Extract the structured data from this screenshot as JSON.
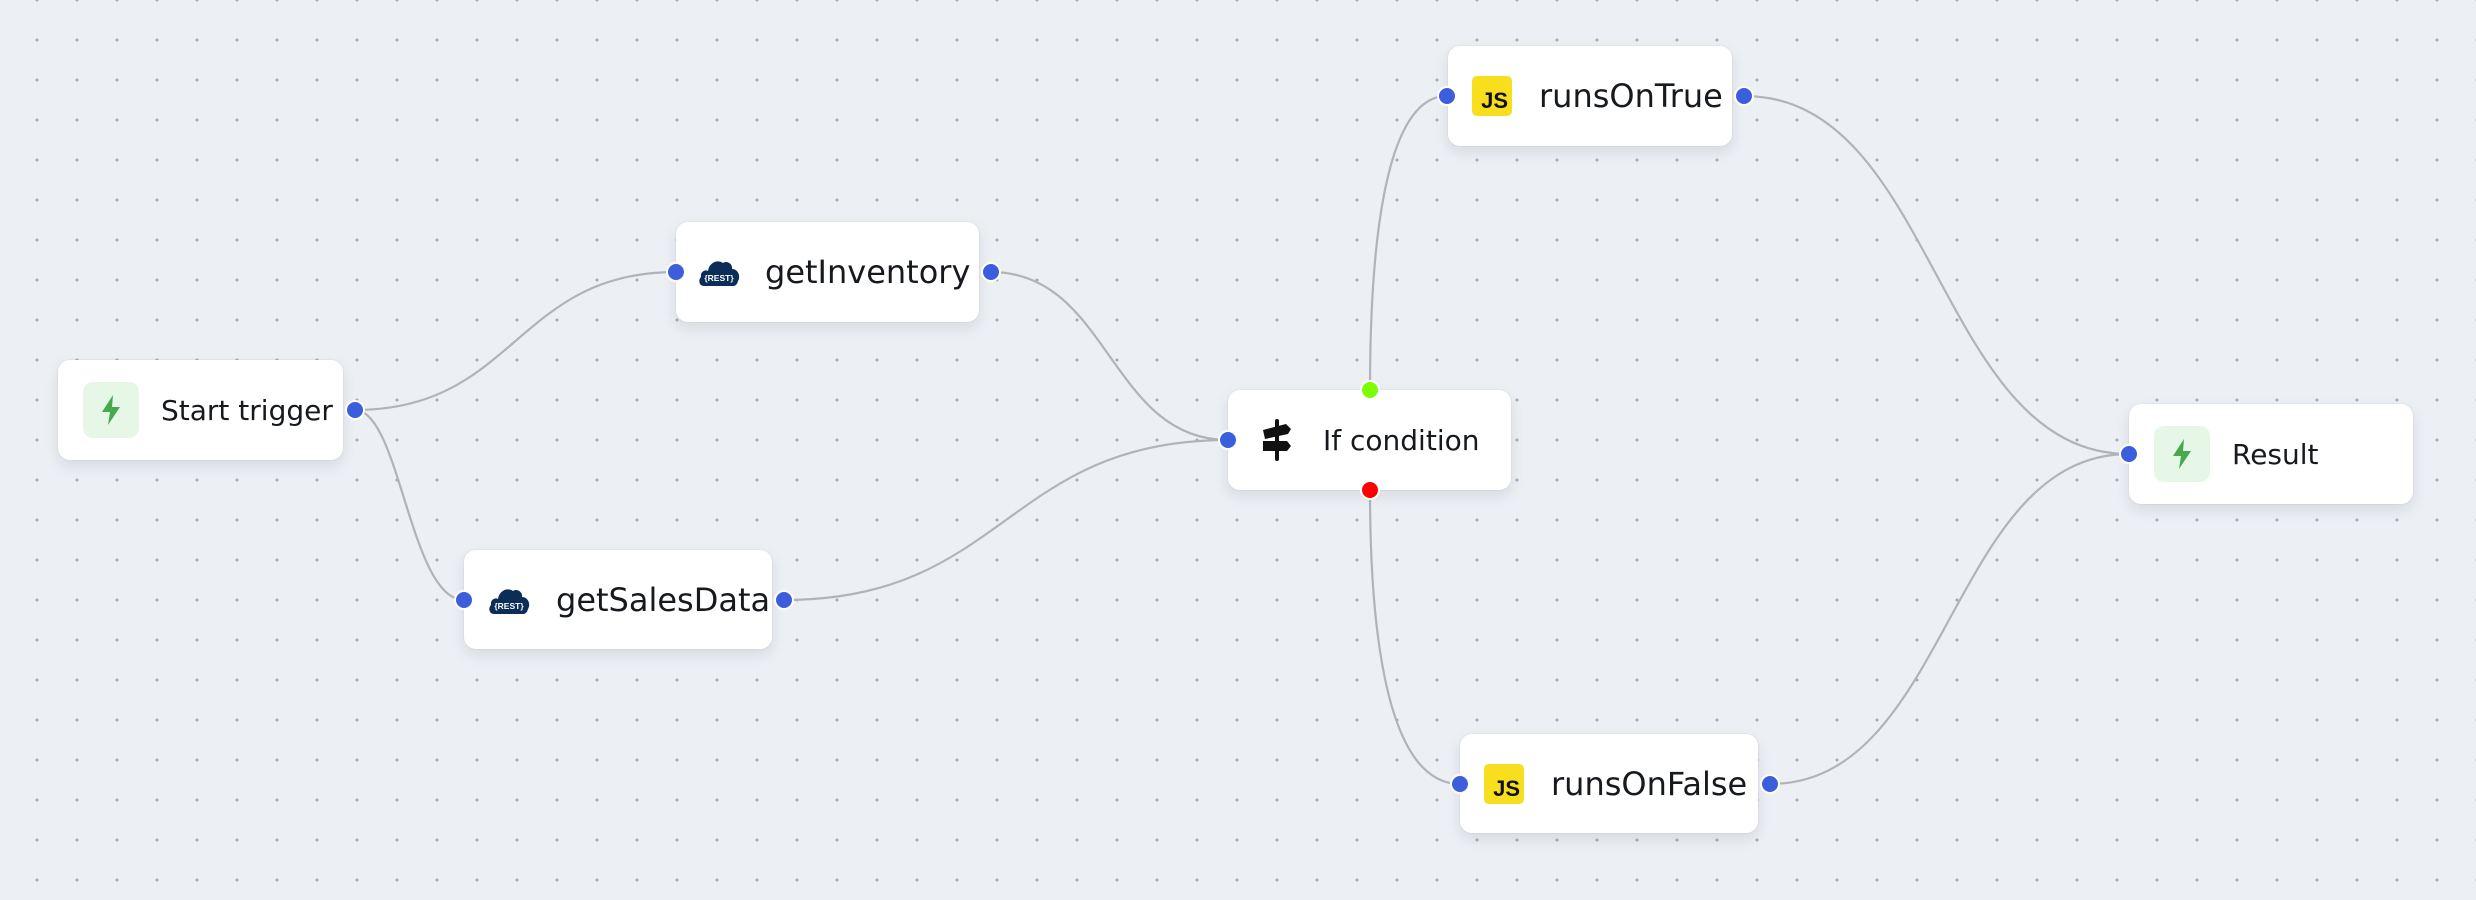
{
  "canvas": {
    "type": "workflow-graph"
  },
  "colors": {
    "handle_default": "#3b5edc",
    "handle_true": "#7cff05",
    "handle_false": "#ff0000",
    "edge": "#b1b3b8",
    "trigger_icon_bg": "#e6f6e7",
    "trigger_icon_fg": "#46a94c",
    "js_badge": "#f7df1e",
    "rest_cloud": "#0c2d57"
  },
  "nodes": [
    {
      "id": "start",
      "label": "Start trigger",
      "icon": "lightning-bolt-icon",
      "kind": "trigger"
    },
    {
      "id": "getInventory",
      "label": "getInventory",
      "icon": "rest-cloud-icon",
      "kind": "rest-api"
    },
    {
      "id": "getSalesData",
      "label": "getSalesData",
      "icon": "rest-cloud-icon",
      "kind": "rest-api"
    },
    {
      "id": "ifCondition",
      "label": "If condition",
      "icon": "signpost-icon",
      "kind": "condition"
    },
    {
      "id": "runsOnTrue",
      "label": "runsOnTrue",
      "icon": "javascript-icon",
      "kind": "javascript",
      "icon_text": "JS"
    },
    {
      "id": "runsOnFalse",
      "label": "runsOnFalse",
      "icon": "javascript-icon",
      "kind": "javascript",
      "icon_text": "JS"
    },
    {
      "id": "result",
      "label": "Result",
      "icon": "lightning-bolt-icon",
      "kind": "result"
    }
  ],
  "edges": [
    {
      "from": "start",
      "to": "getInventory"
    },
    {
      "from": "start",
      "to": "getSalesData"
    },
    {
      "from": "getInventory",
      "to": "ifCondition"
    },
    {
      "from": "getSalesData",
      "to": "ifCondition"
    },
    {
      "from": "ifCondition",
      "to": "runsOnTrue",
      "branch": "true"
    },
    {
      "from": "ifCondition",
      "to": "runsOnFalse",
      "branch": "false"
    },
    {
      "from": "runsOnTrue",
      "to": "result"
    },
    {
      "from": "runsOnFalse",
      "to": "result"
    }
  ],
  "rest_icon_text": "{REST}"
}
